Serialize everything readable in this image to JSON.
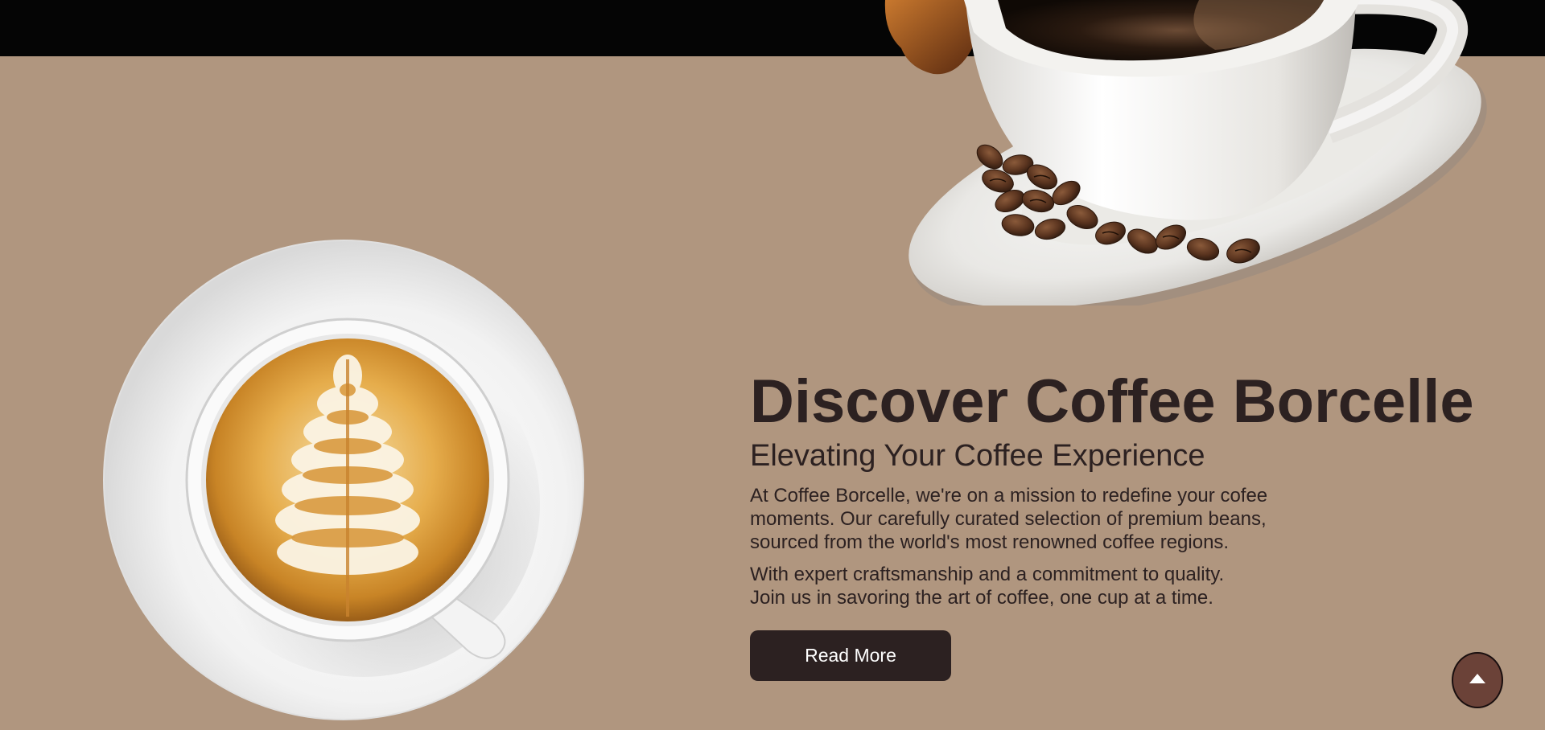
{
  "hero": {
    "title": "Discover Coffee Borcelle",
    "subtitle": "Elevating Your Coffee Experience",
    "paragraph_1_lines": [
      "At Coffee Borcelle, we're on a mission to redefine your cofee",
      "moments. Our carefully curated selection of premium beans,",
      "sourced from the world's most renowned coffee regions."
    ],
    "paragraph_2_lines": [
      "With expert craftsmanship and a commitment to quality.",
      "Join us in savoring the art of coffee, one cup at a time."
    ],
    "button_label": "Read More"
  },
  "scroll_top": {
    "icon": "arrow-up-icon"
  },
  "colors": {
    "background": "#b0967f",
    "top_bar": "#050505",
    "text": "#2c2121",
    "button_bg": "#2c2121",
    "button_text": "#ffffff",
    "scroll_button": "#6b4238"
  }
}
